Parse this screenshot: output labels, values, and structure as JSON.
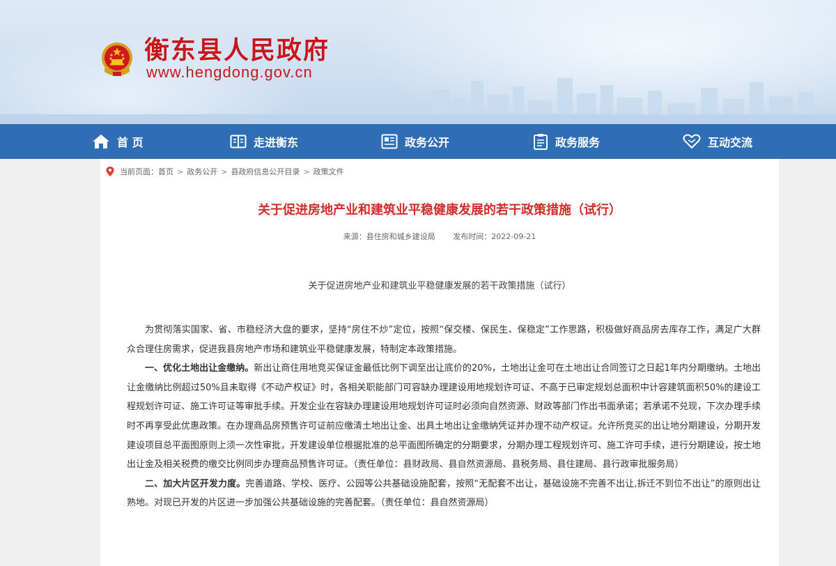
{
  "header": {
    "site_title": "衡东县人民政府",
    "site_url": "www.hengdong.gov.cn",
    "title_color": "#c8161d"
  },
  "nav": {
    "background": "#2f6db5",
    "items": [
      {
        "label": "首 页",
        "icon": "home-icon"
      },
      {
        "label": "走进衡东",
        "icon": "book-icon"
      },
      {
        "label": "政务公开",
        "icon": "newspaper-icon"
      },
      {
        "label": "政务服务",
        "icon": "clipboard-icon"
      },
      {
        "label": "互动交流",
        "icon": "heart-icon"
      }
    ]
  },
  "breadcrumb": {
    "lead": "当前页面：",
    "items": [
      "首页",
      "政务公开",
      "县政府信息公开目录",
      "政策文件"
    ],
    "separator": ">"
  },
  "article": {
    "title": "关于促进房地产业和建筑业平稳健康发展的若干政策措施（试行）",
    "title_color": "#d42b2b",
    "source": "来源：县住房和城乡建设局",
    "publish_time": "发布时间：2022-09-21",
    "subtitle": "关于促进房地产业和建筑业平稳健康发展的若干政策措施（试行）",
    "intro": "为贯彻落实国家、省、市稳经济大盘的要求，坚持“房住不炒”定位，按照“保交楼、保民生、保稳定”工作思路，积极做好商品房去库存工作，满足广大群众合理住房需求，促进我县房地产市场和建筑业平稳健康发展，特制定本政策措施。",
    "sections": [
      {
        "heading": "一、优化土地出让金缴纳。",
        "text": "新出让商住用地竞买保证金最低比例下调至出让底价的20%，土地出让金可在土地出让合同签订之日起1年内分期缴纳。土地出让金缴纳比例超过50%且未取得《不动产权证》时，各相关职能部门可容缺办理建设用地规划许可证、不高于已审定规划总面积中计容建筑面积50%的建设工程规划许可证、施工许可证等审批手续。开发企业在容缺办理建设用地规划许可证时必须向自然资源、财政等部门作出书面承诺；若承诺不兑现，下次办理手续时不再享受此优惠政策。在办理商品房预售许可证前应缴清土地出让金、出具土地出让金缴纳凭证并办理不动产权证。允许所竞买的出让地分期建设，分期开发建设项目总平面图原则上须一次性审批，开发建设单位根据批准的总平面图所确定的分期要求，分期办理工程规划许可、施工许可手续，进行分期建设，按土地出让金及相关税费的缴交比例同步办理商品预售许可证。（责任单位：县财政局、县自然资源局、县税务局、县住建局、县行政审批服务局）"
      },
      {
        "heading": "二、加大片区开发力度。",
        "text": "完善道路、学校、医疗、公园等公共基础设施配套，按照“无配套不出让，基础设施不完善不出让,拆迁不到位不出让”的原则出让熟地。对现已开发的片区进一步加强公共基础设施的完善配套。（责任单位：县自然资源局）"
      }
    ]
  }
}
